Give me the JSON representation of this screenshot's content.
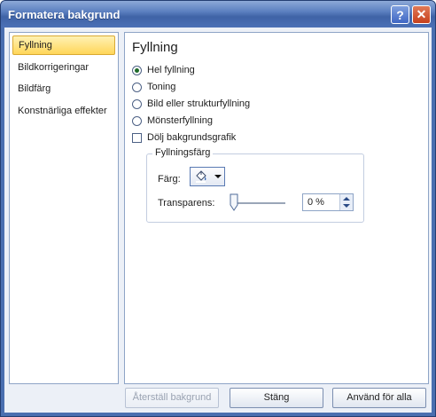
{
  "window": {
    "title": "Formatera bakgrund",
    "help_label": "?",
    "close_label": "✕"
  },
  "nav": {
    "items": [
      {
        "label": "Fyllning",
        "selected": true
      },
      {
        "label": "Bildkorrigeringar",
        "selected": false
      },
      {
        "label": "Bildfärg",
        "selected": false
      },
      {
        "label": "Konstnärliga effekter",
        "selected": false
      }
    ]
  },
  "panel": {
    "title": "Fyllning",
    "options": [
      {
        "label": "Hel fyllning",
        "selected": true
      },
      {
        "label": "Toning",
        "selected": false
      },
      {
        "label": "Bild eller strukturfyllning",
        "selected": false
      },
      {
        "label": "Mönsterfyllning",
        "selected": false
      }
    ],
    "hide_background_graphics": {
      "label": "Dölj bakgrundsgrafik",
      "checked": false
    },
    "fill_color_group": {
      "title": "Fyllningsfärg",
      "color_label": "Färg:",
      "color_icon": "paint-bucket-icon",
      "transparency_label": "Transparens:",
      "transparency_value": "0 %",
      "transparency_level": 0
    }
  },
  "buttons": {
    "reset": "Återställ bakgrund",
    "close": "Stäng",
    "apply_all": "Använd för alla"
  },
  "colors": {
    "title_bar": "#4b71b6",
    "selection": "#ffd659",
    "client_bg": "#ecf0f7"
  }
}
